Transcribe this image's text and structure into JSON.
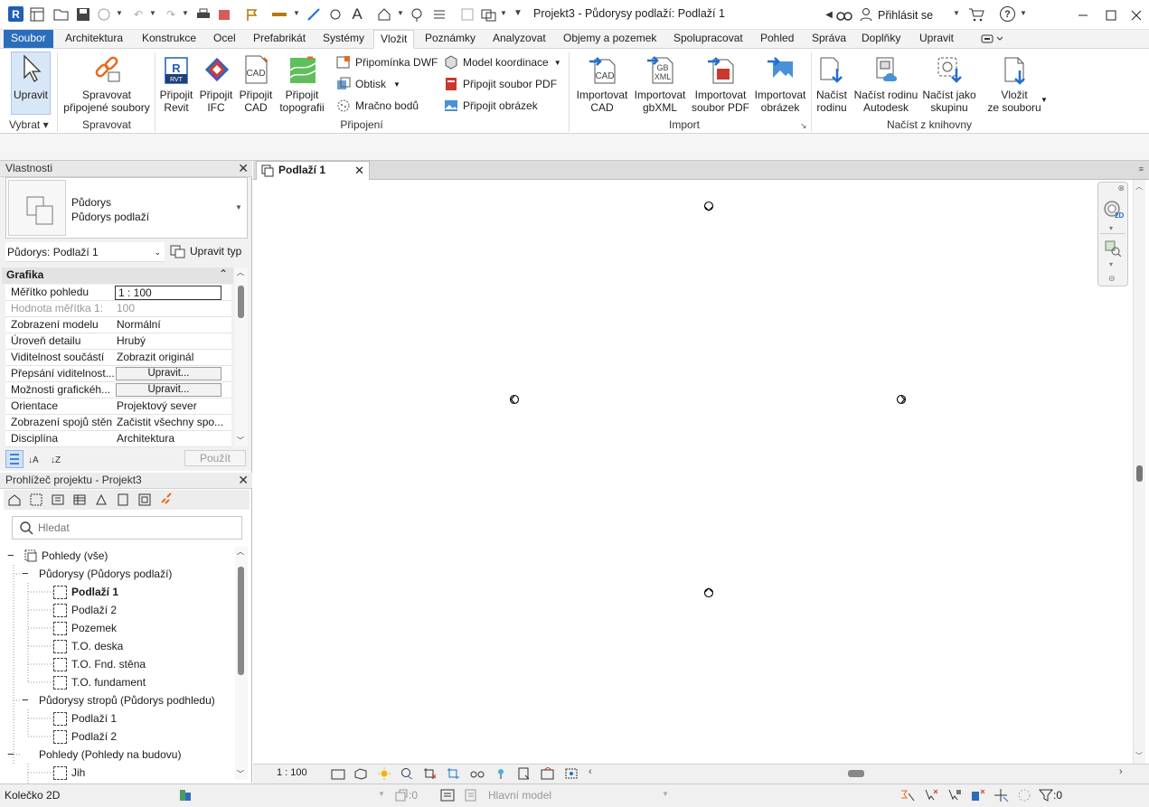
{
  "window": {
    "app_badge": "R",
    "title": "Projekt3 - Půdorysy podlaží: Podlaží 1",
    "sign_in": "Přihlásit se",
    "help": "?"
  },
  "ribbon_tabs": [
    {
      "label": "Soubor"
    },
    {
      "label": "Architektura"
    },
    {
      "label": "Konstrukce"
    },
    {
      "label": "Ocel"
    },
    {
      "label": "Prefabrikát"
    },
    {
      "label": "Systémy"
    },
    {
      "label": "Vložit"
    },
    {
      "label": "Poznámky"
    },
    {
      "label": "Analyzovat"
    },
    {
      "label": "Objemy a pozemek"
    },
    {
      "label": "Spolupracovat"
    },
    {
      "label": "Pohled"
    },
    {
      "label": "Správa"
    },
    {
      "label": "Doplňky"
    },
    {
      "label": "Upravit"
    }
  ],
  "ribbon": {
    "select": {
      "button": "Upravit",
      "panel": "Vybrat"
    },
    "manage": {
      "button": "Spravovat připojené soubory",
      "line1": "Spravovat",
      "line2": "připojené soubory",
      "panel": "Spravovat"
    },
    "link": {
      "revit": [
        "Připojit",
        "Revit"
      ],
      "ifc": [
        "Připojit",
        "IFC"
      ],
      "cad": [
        "Připojit",
        "CAD"
      ],
      "topo": [
        "Připojit",
        "topografii"
      ],
      "dwf_markup": "Připomínka DWF",
      "decal": "Obtisk",
      "point_cloud": "Mračno bodů",
      "coord_model": "Model  koordinace",
      "pdf": "Připojit  soubor PDF",
      "image": "Připojit  obrázek",
      "panel": "Připojení"
    },
    "import": {
      "cad": [
        "Importovat",
        "CAD"
      ],
      "gbxml": [
        "Importovat",
        "gbXML"
      ],
      "pdf": [
        "Importovat",
        "soubor PDF"
      ],
      "image": [
        "Importovat",
        "obrázek"
      ],
      "panel": "Import"
    },
    "library": {
      "family": [
        "Načíst",
        "rodinu"
      ],
      "autodesk": [
        "Načíst rodinu",
        "Autodesk"
      ],
      "group": [
        "Načíst jako",
        "skupinu"
      ],
      "from_file": [
        "Vložit",
        "ze souboru"
      ],
      "panel": "Načíst z knihovny"
    }
  },
  "properties": {
    "title": "Vlastnosti",
    "type_line1": "Půdorys",
    "type_line2": "Půdorys podlaží",
    "instance": "Půdorys: Podlaží 1",
    "edit_type": "Upravit typ",
    "section": "Grafika",
    "rows": [
      {
        "key": "Měřítko pohledu",
        "value": "1 : 100"
      },
      {
        "key": "Hodnota měřítka   1:",
        "value": "100"
      },
      {
        "key": "Zobrazení modelu",
        "value": "Normální"
      },
      {
        "key": "Úroveň detailu",
        "value": "Hrubý"
      },
      {
        "key": "Viditelnost součástí",
        "value": "Zobrazit originál"
      },
      {
        "key": "Přepsání viditelnost...",
        "value": "Upravit..."
      },
      {
        "key": "Možnosti grafickéh...",
        "value": "Upravit..."
      },
      {
        "key": "Orientace",
        "value": "Projektový sever"
      },
      {
        "key": "Zobrazení spojů stěn",
        "value": "Začistit všechny spo..."
      },
      {
        "key": "Disciplína",
        "value": "Architektura"
      }
    ],
    "apply": "Použít"
  },
  "browser": {
    "title": "Prohlížeč projektu - Projekt3",
    "search_placeholder": "Hledat",
    "tree": [
      {
        "label": "Pohledy (vše)"
      },
      {
        "label": "Půdorysy (Půdorys podlaží)"
      },
      {
        "label": "Podlaží 1"
      },
      {
        "label": "Podlaží 2"
      },
      {
        "label": "Pozemek"
      },
      {
        "label": "T.O. deska"
      },
      {
        "label": "T.O. Fnd. stěna"
      },
      {
        "label": "T.O. fundament"
      },
      {
        "label": "Půdorysy stropů (Půdorys podhledu)"
      },
      {
        "label": "Podlaží 1"
      },
      {
        "label": "Podlaží 2"
      },
      {
        "label": "Pohledy (Pohledy na budovu)"
      },
      {
        "label": "Jih"
      }
    ]
  },
  "view": {
    "tab": "Podlaží 1",
    "scale": "1 : 100",
    "navbar_2d": "2D"
  },
  "status": {
    "text": "Kolečko 2D",
    "workset_count": ":0",
    "model": "Hlavní model",
    "filter_count": ":0"
  },
  "colors": {
    "file_tab": "#2a6ebb",
    "accent_blue": "#1f6fd0",
    "revit_logo": "#1f5fb4"
  }
}
